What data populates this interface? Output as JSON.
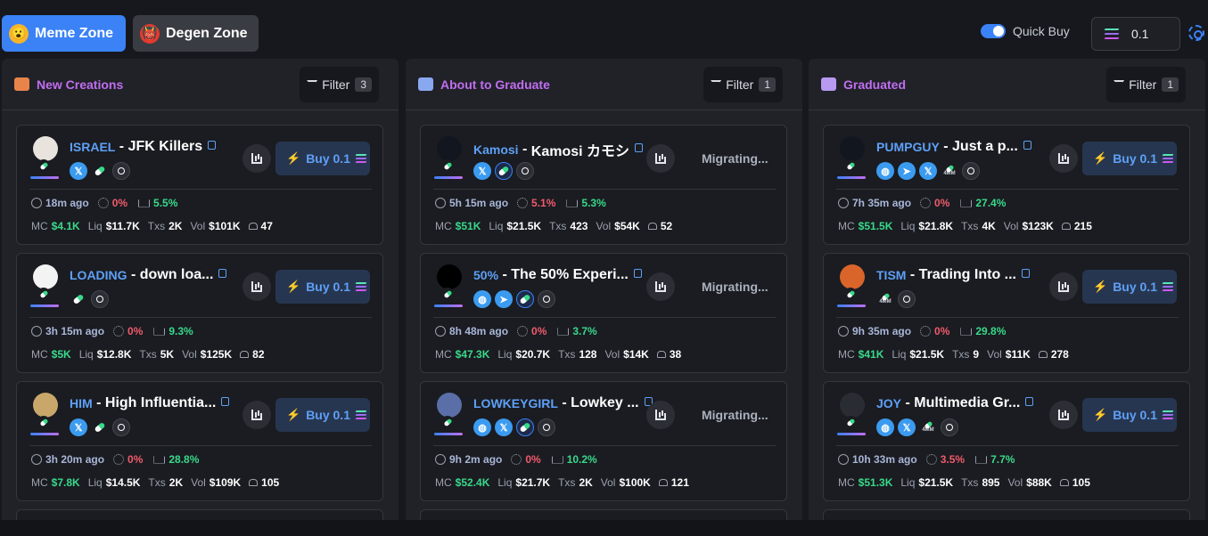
{
  "zones": [
    {
      "label": "Meme Zone",
      "emoji": "😮"
    },
    {
      "label": "Degen Zone",
      "emoji": "👹"
    }
  ],
  "quick_buy": {
    "label": "Quick Buy",
    "enabled": true,
    "amount": "0.1"
  },
  "colors": {
    "accent": "#3b82f6",
    "purple": "#c16ef0",
    "green": "#39d98a",
    "red": "#f05a6b"
  },
  "columns": [
    {
      "title": "New Creations",
      "icon": "pencil-icon",
      "filter_label": "Filter",
      "filter_count": "3",
      "cards": [
        {
          "ticker": "ISRAEL",
          "name": "JFK Killers",
          "socials": [
            "x",
            "pill",
            "search"
          ],
          "action": "Buy 0.1",
          "age": "18m ago",
          "pct1": "0%",
          "pct2": "5.5%",
          "mc": "$4.1K",
          "liq": "$11.7K",
          "txs": "2K",
          "vol": "$101K",
          "holders": "47",
          "avatar_color": "#e9e3de"
        },
        {
          "ticker": "LOADING",
          "name": "down loa...",
          "socials": [
            "pill",
            "search"
          ],
          "action": "Buy 0.1",
          "age": "3h 15m ago",
          "pct1": "0%",
          "pct2": "9.3%",
          "mc": "$5K",
          "liq": "$12.8K",
          "txs": "5K",
          "vol": "$125K",
          "holders": "82",
          "avatar_color": "#f3f3f3"
        },
        {
          "ticker": "HIM",
          "name": "High Influentia...",
          "socials": [
            "x",
            "pill",
            "search"
          ],
          "action": "Buy 0.1",
          "age": "3h 20m ago",
          "pct1": "0%",
          "pct2": "28.8%",
          "mc": "$7.8K",
          "liq": "$14.5K",
          "txs": "2K",
          "vol": "$109K",
          "holders": "105",
          "avatar_color": "#c9a76a"
        }
      ]
    },
    {
      "title": "About to Graduate",
      "icon": "scroll-icon",
      "filter_label": "Filter",
      "filter_count": "1",
      "cards": [
        {
          "ticker": "Kamosi",
          "name": "Kamosi カモシ",
          "socials": [
            "x",
            "pill-b",
            "search"
          ],
          "action": "Migrating...",
          "age": "5h 15m ago",
          "pct1": "5.1%",
          "pct2": "5.3%",
          "mc": "$51K",
          "liq": "$21.5K",
          "txs": "423",
          "vol": "$54K",
          "holders": "52",
          "avatar_color": "#12161f"
        },
        {
          "ticker": "50%",
          "name": "The 50% Experi...",
          "socials": [
            "web",
            "tg",
            "pill-b",
            "search"
          ],
          "action": "Migrating...",
          "age": "8h 48m ago",
          "pct1": "0%",
          "pct2": "3.7%",
          "mc": "$47.3K",
          "liq": "$20.7K",
          "txs": "128",
          "vol": "$14K",
          "holders": "38",
          "avatar_color": "#000000"
        },
        {
          "ticker": "LOWKEYGIRL",
          "name": "Lowkey ...",
          "socials": [
            "web",
            "x",
            "pill-b",
            "search"
          ],
          "action": "Migrating...",
          "age": "9h 2m ago",
          "pct1": "0%",
          "pct2": "10.2%",
          "mc": "$52.4K",
          "liq": "$21.7K",
          "txs": "2K",
          "vol": "$100K",
          "holders": "121",
          "avatar_color": "#5a6ea8"
        }
      ]
    },
    {
      "title": "Graduated",
      "icon": "grad-cap-icon",
      "filter_label": "Filter",
      "filter_count": "1",
      "cards": [
        {
          "ticker": "PUMPGUY",
          "name": "Just a p...",
          "socials": [
            "web",
            "tg",
            "x",
            "4mm",
            "search"
          ],
          "action": "Buy 0.1",
          "age": "7h 35m ago",
          "pct1": "0%",
          "pct2": "27.4%",
          "mc": "$51.5K",
          "liq": "$21.8K",
          "txs": "4K",
          "vol": "$123K",
          "holders": "215",
          "avatar_color": "#12161f"
        },
        {
          "ticker": "TISM",
          "name": "Trading Into ...",
          "socials": [
            "4mm",
            "search"
          ],
          "action": "Buy 0.1",
          "age": "9h 35m ago",
          "pct1": "0%",
          "pct2": "29.8%",
          "mc": "$41K",
          "liq": "$21.5K",
          "txs": "9",
          "vol": "$11K",
          "holders": "278",
          "avatar_color": "#d9652b"
        },
        {
          "ticker": "JOY",
          "name": "Multimedia Gr...",
          "socials": [
            "web",
            "x",
            "4mm",
            "search"
          ],
          "action": "Buy 0.1",
          "age": "10h 33m ago",
          "pct1": "3.5%",
          "pct2": "7.7%",
          "mc": "$51.3K",
          "liq": "$21.5K",
          "txs": "895",
          "vol": "$88K",
          "holders": "105",
          "avatar_color": "#2a2c33"
        }
      ]
    }
  ],
  "labels": {
    "mc": "MC",
    "liq": "Liq",
    "txs": "Txs",
    "vol": "Vol",
    "four_mm": "4MM"
  }
}
